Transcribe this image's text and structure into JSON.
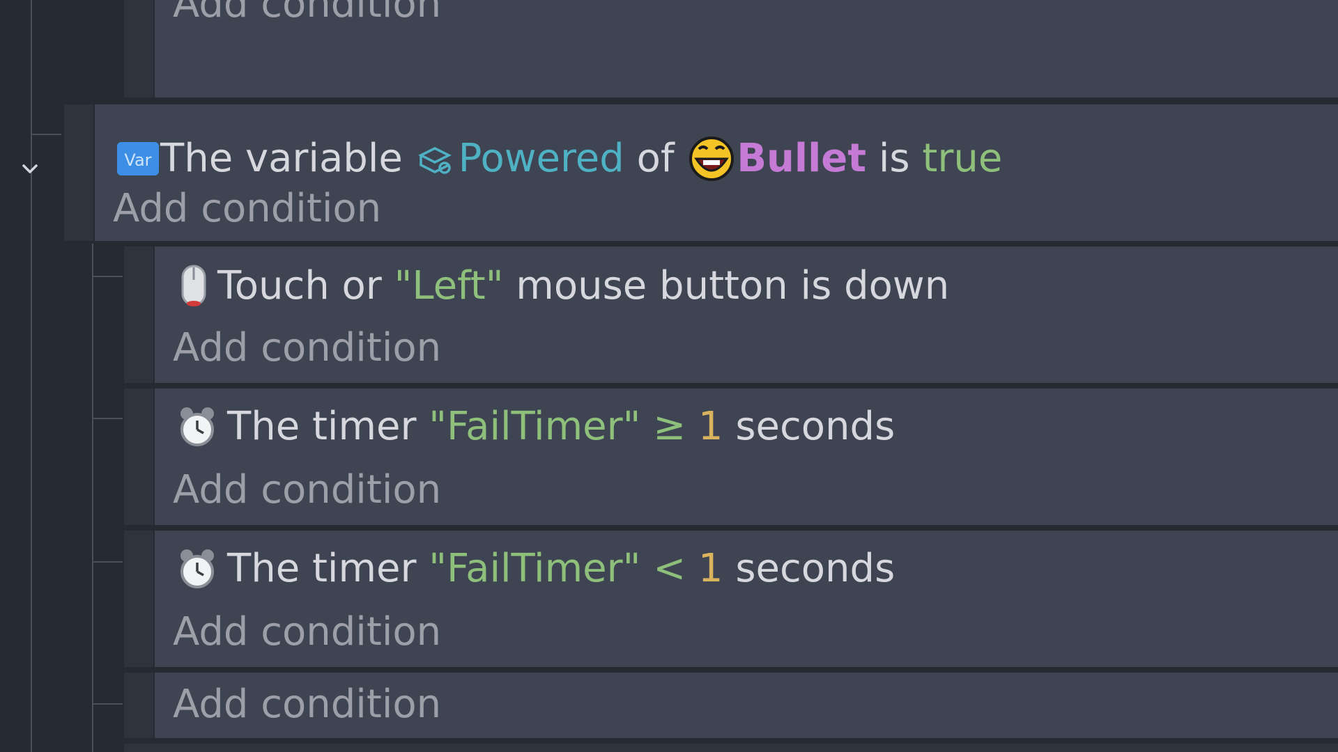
{
  "events": {
    "top_partial": {
      "add_condition": "Add condition"
    },
    "parent": {
      "condition": {
        "icon": "var-icon",
        "prefix": "The variable ",
        "variable": "Powered",
        "of": " of ",
        "object": "Bullet",
        "is": " is ",
        "value": "true"
      },
      "add_condition": "Add condition"
    },
    "children": [
      {
        "icon": "mouse-icon",
        "text_before": "Touch or ",
        "string": "\"Left\"",
        "text_after": " mouse button is down",
        "add_condition": "Add condition"
      },
      {
        "icon": "timer-icon",
        "text_before": "The timer ",
        "string": "\"FailTimer\"",
        "operator": " ≥ ",
        "number": "1",
        "text_after": " seconds",
        "add_condition": "Add condition"
      },
      {
        "icon": "timer-icon",
        "text_before": "The timer ",
        "string": "\"FailTimer\"",
        "operator": " < ",
        "number": "1",
        "text_after": " seconds",
        "add_condition": "Add condition"
      },
      {
        "add_condition": "Add condition"
      }
    ]
  },
  "colors": {
    "background": "#262a33",
    "event_block": "#3f4452",
    "variable_param": "#4fb1c4",
    "object": "#c57ad6",
    "value": "#8ec07c",
    "number": "#d9b35e",
    "add_condition": "#9c9fa8"
  }
}
